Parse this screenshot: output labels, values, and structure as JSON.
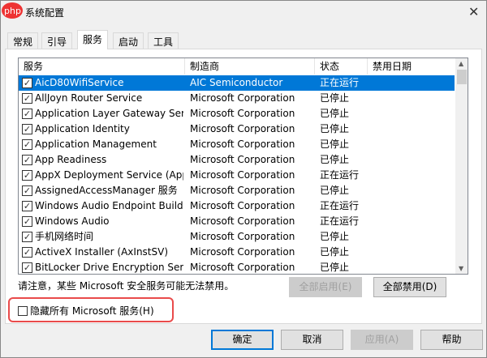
{
  "window": {
    "title": "系统配置",
    "watermark": "php中文网",
    "close_icon": "close-icon"
  },
  "tabs": [
    {
      "label": "常规"
    },
    {
      "label": "引导"
    },
    {
      "label": "服务",
      "active": true
    },
    {
      "label": "启动"
    },
    {
      "label": "工具"
    }
  ],
  "columns": [
    "服务",
    "制造商",
    "状态",
    "禁用日期"
  ],
  "rows": [
    {
      "name": "AicD80WifiService",
      "maker": "AIC Semiconductor",
      "status": "正在运行",
      "checked": true,
      "selected": true
    },
    {
      "name": "AllJoyn Router Service",
      "maker": "Microsoft Corporation",
      "status": "已停止",
      "checked": true
    },
    {
      "name": "Application Layer Gateway Service",
      "maker": "Microsoft Corporation",
      "status": "已停止",
      "checked": true
    },
    {
      "name": "Application Identity",
      "maker": "Microsoft Corporation",
      "status": "已停止",
      "checked": true
    },
    {
      "name": "Application Management",
      "maker": "Microsoft Corporation",
      "status": "已停止",
      "checked": true
    },
    {
      "name": "App Readiness",
      "maker": "Microsoft Corporation",
      "status": "已停止",
      "checked": true
    },
    {
      "name": "AppX Deployment Service (AppX...",
      "maker": "Microsoft Corporation",
      "status": "正在运行",
      "checked": true
    },
    {
      "name": "AssignedAccessManager 服务",
      "maker": "Microsoft Corporation",
      "status": "已停止",
      "checked": true
    },
    {
      "name": "Windows Audio Endpoint Builder",
      "maker": "Microsoft Corporation",
      "status": "正在运行",
      "checked": true
    },
    {
      "name": "Windows Audio",
      "maker": "Microsoft Corporation",
      "status": "正在运行",
      "checked": true
    },
    {
      "name": "手机网络时间",
      "maker": "Microsoft Corporation",
      "status": "已停止",
      "checked": true
    },
    {
      "name": "ActiveX Installer (AxInstSV)",
      "maker": "Microsoft Corporation",
      "status": "已停止",
      "checked": true
    },
    {
      "name": "BitLocker Drive Encryption Service",
      "maker": "Microsoft Corporation",
      "status": "已停止",
      "checked": true
    }
  ],
  "note": "请注意，某些 Microsoft 安全服务可能无法禁用。",
  "enable_all": "全部启用(E)",
  "disable_all": "全部禁用(D)",
  "hide_ms": {
    "label": "隐藏所有 Microsoft 服务(H)",
    "checked": false
  },
  "buttons": {
    "ok": "确定",
    "cancel": "取消",
    "apply": "应用(A)",
    "help": "帮助"
  },
  "colors": {
    "selection": "#0078d7",
    "highlight": "#e94b4b"
  }
}
